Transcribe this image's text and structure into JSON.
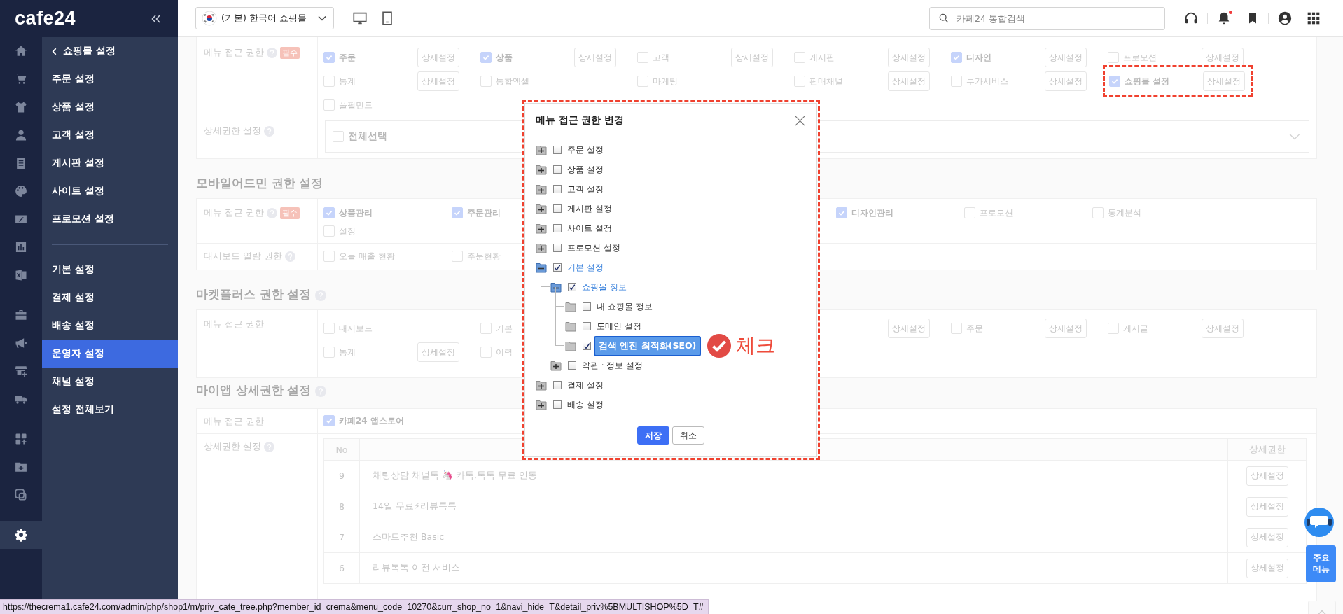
{
  "sidebar": {
    "logo": "cafe24",
    "back_title": "쇼핑몰 설정",
    "rail": [
      {
        "selected": false
      },
      {
        "selected": false
      },
      {
        "selected": false
      },
      {
        "selected": false
      },
      {
        "selected": false
      },
      {
        "selected": false
      },
      {
        "selected": false
      },
      {
        "selected": false
      },
      {
        "selected": false
      },
      {
        "selected": false
      },
      {
        "selected": false
      },
      {
        "selected": false
      },
      {
        "selected": false
      },
      {
        "selected": false
      },
      {
        "selected": false
      },
      {
        "selected": false
      },
      {
        "selected": true
      }
    ],
    "groups": [
      [
        {
          "label": "주문 설정",
          "selected": false
        },
        {
          "label": "상품 설정",
          "selected": false
        },
        {
          "label": "고객 설정",
          "selected": false
        },
        {
          "label": "게시판 설정",
          "selected": false
        },
        {
          "label": "사이트 설정",
          "selected": false
        },
        {
          "label": "프로모션 설정",
          "selected": false
        }
      ],
      [
        {
          "label": "기본 설정",
          "selected": false
        },
        {
          "label": "결제 설정",
          "selected": false
        },
        {
          "label": "배송 설정",
          "selected": false
        },
        {
          "label": "운영자 설정",
          "selected": true
        },
        {
          "label": "채널 설정",
          "selected": false
        },
        {
          "label": "설정 전체보기",
          "selected": false
        }
      ]
    ]
  },
  "header": {
    "shop": "(기본) 한국어 쇼핑몰",
    "search": {
      "placeholder": "카페24 통합검색"
    },
    "notifications": {
      "unread": true
    }
  },
  "shop_permissions": {
    "menu_access": {
      "label": "메뉴 접근 권한",
      "help": true,
      "badge": "필수",
      "items": [
        {
          "label": "주문",
          "checked": true,
          "button": "상세설정"
        },
        {
          "label": "상품",
          "checked": true,
          "button": "상세설정"
        },
        {
          "label": "고객",
          "checked": false,
          "button": "상세설정"
        },
        {
          "label": "게시판",
          "checked": false,
          "button": "상세설정"
        },
        {
          "label": "디자인",
          "checked": true,
          "button": "상세설정"
        },
        {
          "label": "프로모션",
          "checked": false,
          "button": "상세설정"
        },
        {
          "label": "통계",
          "checked": false,
          "button": "상세설정"
        },
        {
          "label": "통합엑셀",
          "checked": false
        },
        {
          "label": "마케팅",
          "checked": false
        },
        {
          "label": "판매채널",
          "checked": false,
          "button": "상세설정"
        },
        {
          "label": "부가서비스",
          "checked": false,
          "button": "상세설정"
        },
        {
          "label": "쇼핑몰 설정",
          "checked": true,
          "button": "상세설정",
          "highlighted": true
        },
        {
          "label": "풀필먼트",
          "checked": false
        }
      ]
    },
    "detail": {
      "label": "상세권한 설정",
      "help": true,
      "select_all": {
        "label": "전체선택",
        "checked": false
      }
    }
  },
  "mobile_admin": {
    "title": "모바일어드민 권한 설정",
    "menu_access": {
      "label": "메뉴 접근 권한",
      "help": true,
      "badge": "필수",
      "items": [
        {
          "label": "상품관리",
          "checked": true
        },
        {
          "label": "주문관리",
          "checked": true
        },
        {
          "label": "디자인관리",
          "checked": true
        },
        {
          "label": "프로모션",
          "checked": false
        },
        {
          "label": "통계분석",
          "checked": false
        },
        {
          "label": "설정",
          "checked": false
        }
      ]
    },
    "dashboard": {
      "label": "대시보드 열람 권한",
      "help": true,
      "items": [
        {
          "label": "오늘 매출 현황",
          "checked": false
        },
        {
          "label": "주문현황",
          "checked": false
        }
      ]
    }
  },
  "marketplus": {
    "title": "마켓플러스 권한 설정",
    "help": true,
    "menu_access": {
      "label": "메뉴 접근 권한",
      "items": [
        {
          "label": "대시보드",
          "checked": false
        },
        {
          "label": "기본",
          "checked": false
        },
        {
          "button": "상세설정"
        },
        {
          "label": "주문",
          "checked": false,
          "button": "상세설정"
        },
        {
          "label": "게시글",
          "checked": false,
          "button": "상세설정"
        },
        {
          "label": "통계",
          "checked": false,
          "button": "상세설정"
        },
        {
          "label": "이력",
          "checked": false
        }
      ]
    }
  },
  "myapp": {
    "title": "마이앱 상세권한 설정",
    "help": true,
    "menu_access": {
      "label": "메뉴 접근 권한",
      "items": [
        {
          "label": "카페24 앱스토어",
          "checked": true
        }
      ]
    },
    "detail": {
      "label": "상세권한 설정",
      "help": true,
      "columns": {
        "no": "No",
        "detail": "상세권한"
      },
      "rows": [
        {
          "no": "9",
          "name": "채팅상담 채널톡 🦄 카톡,톡톡 무료 연동",
          "button": "상세설정"
        },
        {
          "no": "8",
          "name": "14일 무료⚡리뷰톡톡",
          "button": "상세설정"
        },
        {
          "no": "7",
          "name": "스마트추천 Basic",
          "button": "상세설정"
        },
        {
          "no": "6",
          "name": "리뷰톡톡 이전 서비스",
          "button": "상세설정"
        }
      ]
    }
  },
  "dialog": {
    "title": "메뉴 접근 권한 변경",
    "tree": [
      {
        "label": "주문 설정",
        "kind": "folder",
        "expanded": false,
        "checked": false,
        "selected": false
      },
      {
        "label": "상품 설정",
        "kind": "folder",
        "expanded": false,
        "checked": false,
        "selected": false
      },
      {
        "label": "고객 설정",
        "kind": "folder",
        "expanded": false,
        "checked": false,
        "selected": false
      },
      {
        "label": "게시판 설정",
        "kind": "folder",
        "expanded": false,
        "checked": false,
        "selected": false
      },
      {
        "label": "사이트 설정",
        "kind": "folder",
        "expanded": false,
        "checked": false,
        "selected": false
      },
      {
        "label": "프로모션 설정",
        "kind": "folder",
        "expanded": false,
        "checked": false,
        "selected": false
      },
      {
        "label": "기본 설정",
        "kind": "folder",
        "expanded": true,
        "checked": true,
        "selected": false,
        "children": [
          {
            "label": "쇼핑몰 정보",
            "kind": "folder",
            "expanded": true,
            "checked": true,
            "selected": false,
            "children": [
              {
                "label": "내 쇼핑몰 정보",
                "kind": "leaf",
                "checked": false,
                "selected": false
              },
              {
                "label": "도메인 설정",
                "kind": "leaf",
                "checked": false,
                "selected": false
              },
              {
                "label": "검색 엔진 최적화(SEO)",
                "kind": "leaf",
                "checked": true,
                "selected": true,
                "annotation": "체크"
              }
            ]
          },
          {
            "label": "약관 · 정보 설정",
            "kind": "folder",
            "expanded": false,
            "checked": false,
            "selected": false
          }
        ]
      },
      {
        "label": "결제 설정",
        "kind": "folder",
        "expanded": false,
        "checked": false,
        "selected": false
      },
      {
        "label": "배송 설정",
        "kind": "folder",
        "expanded": false,
        "checked": false,
        "selected": false
      }
    ],
    "buttons": [
      {
        "label": "저장",
        "kind": "primary"
      },
      {
        "label": "취소",
        "kind": "secondary"
      }
    ]
  },
  "floating": {
    "menu_button": "주요 메뉴"
  },
  "status_bar": {
    "url": "https://thecrema1.cafe24.com/admin/php/shop1/m/priv_cate_tree.php?member_id=crema&menu_code=10270&curr_shop_no=1&navi_hide=T&detail_priv%5BMULTISHOP%5D=T#"
  }
}
